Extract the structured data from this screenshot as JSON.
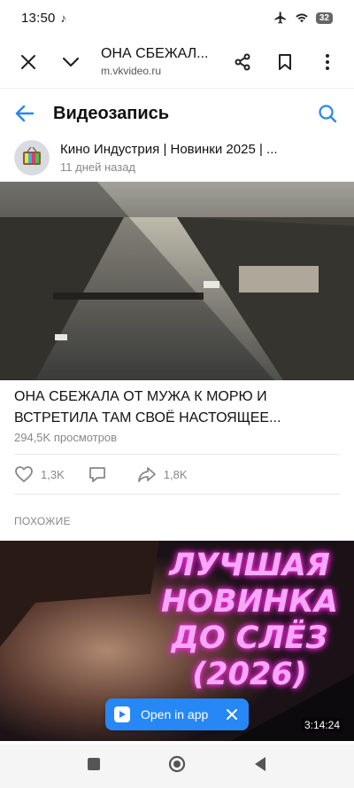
{
  "status_bar": {
    "time": "13:50",
    "app_icon": "tiktok-icon",
    "battery": "32"
  },
  "browser": {
    "page_title": "ОНА СБЕЖАЛ...",
    "url": "m.vkvideo.ru"
  },
  "header": {
    "title": "Видеозапись"
  },
  "author": {
    "name": "Кино Индустрия | Новинки 2025 | ...",
    "time_ago": "11 дней назад"
  },
  "video": {
    "title_line1": "ОНА СБЕЖАЛА ОТ МУЖА К МОРЮ И",
    "title_line2": "ВСТРЕТИЛА ТАМ СВОЁ НАСТОЯЩЕЕ...",
    "views": "294,5K просмотров",
    "likes": "1,3K",
    "shares": "1,8K"
  },
  "similar": {
    "label": "ПОХОЖИЕ",
    "overlay_lines": [
      "ЛУЧШАЯ",
      "НОВИНКА",
      "ДО СЛЁЗ",
      "(2026)"
    ],
    "duration": "3:14:24"
  },
  "open_app": {
    "label": "Open in app"
  },
  "colors": {
    "accent": "#2787f5",
    "overlay_text": "#f6a8f8"
  }
}
